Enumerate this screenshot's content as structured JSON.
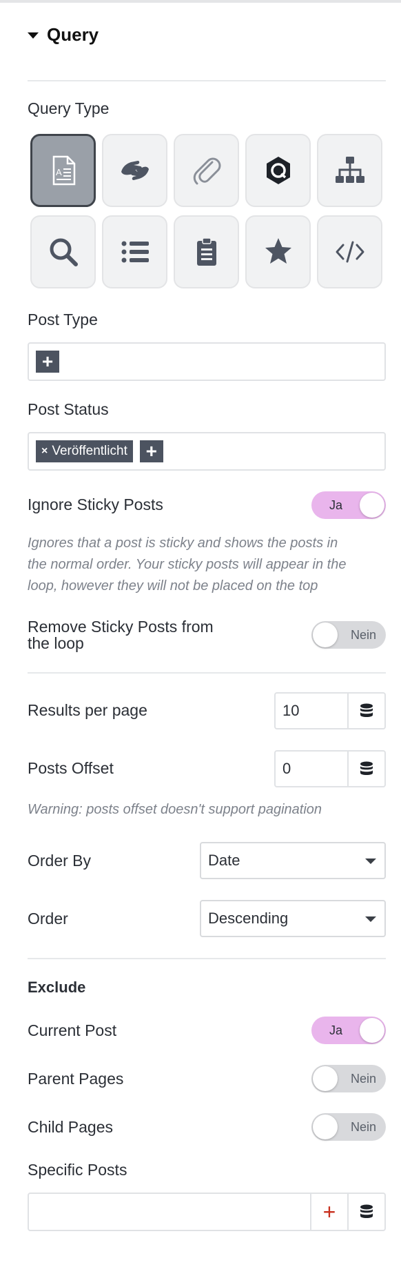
{
  "section": {
    "title": "Query"
  },
  "query_type": {
    "label": "Query Type",
    "tiles": [
      {
        "icon": "document-icon",
        "active": true
      },
      {
        "icon": "sign-language-icon",
        "active": false
      },
      {
        "icon": "paperclip-icon",
        "active": false
      },
      {
        "icon": "hexagon-logo-icon",
        "active": false
      },
      {
        "icon": "sitemap-icon",
        "active": false
      },
      {
        "icon": "search-icon",
        "active": false
      },
      {
        "icon": "list-icon",
        "active": false
      },
      {
        "icon": "clipboard-icon",
        "active": false
      },
      {
        "icon": "star-icon",
        "active": false
      },
      {
        "icon": "code-icon",
        "active": false
      }
    ]
  },
  "post_type": {
    "label": "Post Type",
    "add": "+"
  },
  "post_status": {
    "label": "Post Status",
    "chip_remove": "×",
    "chip": "Veröffentlicht",
    "add": "+"
  },
  "ignore_sticky": {
    "label": "Ignore Sticky Posts",
    "toggle": "Ja",
    "help_lines": [
      "Ignores that a post is sticky and shows the posts in",
      "the normal order. Your sticky posts will appear in the",
      "loop, however they will not be placed on the top"
    ]
  },
  "remove_sticky": {
    "label_line1": "Remove Sticky Posts from",
    "label_line2": "the loop",
    "toggle": "Nein"
  },
  "results_per_page": {
    "label": "Results per page",
    "value": "10"
  },
  "posts_offset": {
    "label": "Posts Offset",
    "value": "0",
    "warning": "Warning: posts offset doesn't support pagination"
  },
  "order_by": {
    "label": "Order By",
    "value": "Date"
  },
  "order": {
    "label": "Order",
    "value": "Descending"
  },
  "exclude": {
    "heading": "Exclude",
    "current_post": {
      "label": "Current Post",
      "toggle": "Ja"
    },
    "parent_pages": {
      "label": "Parent Pages",
      "toggle": "Nein"
    },
    "child_pages": {
      "label": "Child Pages",
      "toggle": "Nein"
    },
    "specific_posts": {
      "label": "Specific Posts",
      "add": "+"
    }
  },
  "colors": {
    "toggle_on": "#e9b5ec",
    "toggle_off": "#d8d9dc",
    "accent_red": "#c8301e",
    "chip": "#4c5360"
  }
}
